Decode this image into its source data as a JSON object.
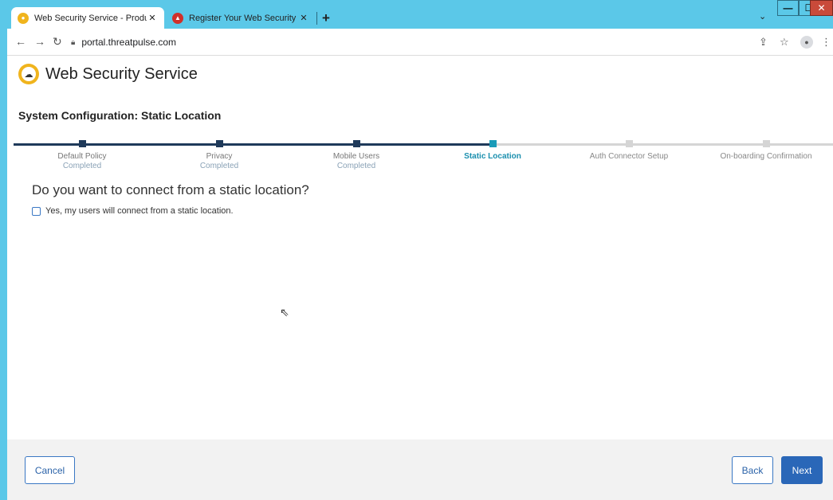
{
  "browser": {
    "tabs": [
      {
        "title": "Web Security Service - Product S",
        "active": true,
        "favicon_color": "#f0b41d"
      },
      {
        "title": "Register Your Web Security Servi",
        "active": false,
        "favicon_color": "#d0302a"
      }
    ],
    "new_tab": "+",
    "close_glyph": "✕",
    "url": "portal.threatpulse.com",
    "window_controls": {
      "minimize": "—",
      "maximize": "☐",
      "close": "✕"
    }
  },
  "app": {
    "brand_name": "Web Security Service"
  },
  "page": {
    "heading": "System Configuration:  Static Location",
    "steps": [
      {
        "label": "Default Policy",
        "sub": "Completed",
        "status": "completed"
      },
      {
        "label": "Privacy",
        "sub": "Completed",
        "status": "completed"
      },
      {
        "label": "Mobile Users",
        "sub": "Completed",
        "status": "completed"
      },
      {
        "label": "Static Location",
        "sub": "",
        "status": "current"
      },
      {
        "label": "Auth Connector Setup",
        "sub": "",
        "status": "pending"
      },
      {
        "label": "On-boarding Confirmation",
        "sub": "",
        "status": "pending"
      }
    ],
    "question": "Do you want to connect from a static location?",
    "checkbox_label": "Yes, my users will connect from a static location.",
    "checkbox_checked": false
  },
  "footer": {
    "cancel": "Cancel",
    "back": "Back",
    "next": "Next"
  },
  "colors": {
    "accent": "#1a9bb8",
    "completed": "#1f3a5a",
    "primary_button": "#2a67b8",
    "chrome": "#5bc8e8"
  }
}
